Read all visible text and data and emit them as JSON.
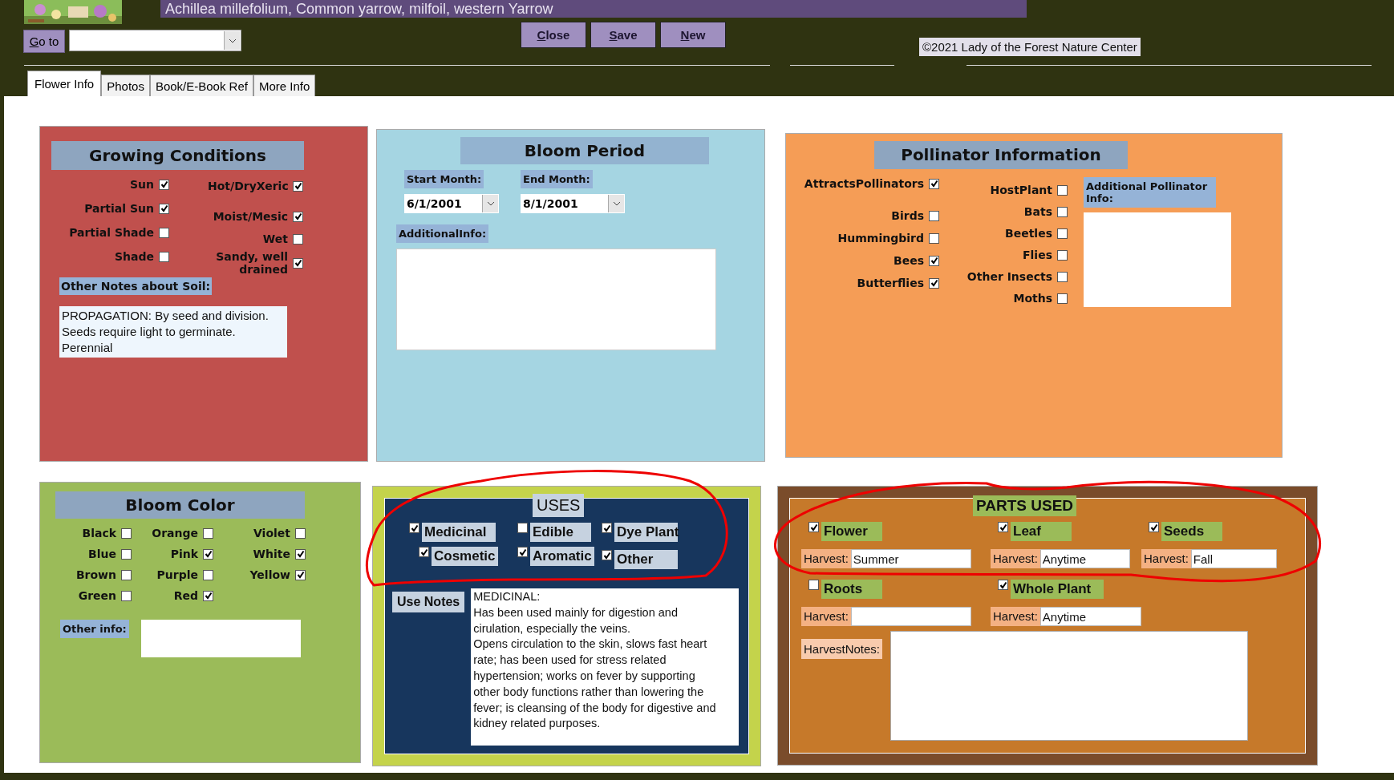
{
  "title": "Achillea millefolium, Common yarrow, milfoil, western Yarrow",
  "goto": {
    "label": "Go to"
  },
  "buttons": [
    "Close",
    "Save",
    "New"
  ],
  "copyright": "©2021 Lady of the Forest Nature Center",
  "tabs": [
    {
      "label": "Flower Info",
      "selected": true
    },
    {
      "label": "Photos",
      "selected": false
    },
    {
      "label": "Book/E-Book Ref",
      "selected": false
    },
    {
      "label": "More Info",
      "selected": false
    }
  ],
  "growing": {
    "title": "Growing Conditions",
    "left": [
      {
        "label": "Sun",
        "checked": true
      },
      {
        "label": "Partial Sun",
        "checked": true
      },
      {
        "label": "Partial Shade",
        "checked": false
      },
      {
        "label": "Shade",
        "checked": false
      }
    ],
    "right": [
      {
        "label": "Hot/DryXeric",
        "checked": true
      },
      {
        "label": "Moist/Mesic",
        "checked": true
      },
      {
        "label": "Wet",
        "checked": false
      },
      {
        "label": "Sandy, well drained",
        "checked": true
      }
    ],
    "notes_label": "Other Notes about Soil:",
    "notes": "PROPAGATION: By seed and division. Seeds require light to germinate. Perennial"
  },
  "bloom_period": {
    "title": "Bloom Period",
    "start": {
      "label": "Start Month:",
      "value": "6/1/2001"
    },
    "end": {
      "label": "End Month:",
      "value": "8/1/2001"
    },
    "info_label": "AdditionalInfo:"
  },
  "pollinators": {
    "title": "Pollinator Information",
    "left": [
      {
        "label": "AttractsPollinators",
        "checked": true
      },
      {
        "label": "Birds",
        "checked": false
      },
      {
        "label": "Hummingbird",
        "checked": false
      },
      {
        "label": "Bees",
        "checked": true
      },
      {
        "label": "Butterflies",
        "checked": true
      }
    ],
    "right": [
      {
        "label": "HostPlant",
        "checked": false
      },
      {
        "label": "Bats",
        "checked": false
      },
      {
        "label": "Beetles",
        "checked": false
      },
      {
        "label": "Flies",
        "checked": false
      },
      {
        "label": "Other Insects",
        "checked": false
      },
      {
        "label": "Moths",
        "checked": false
      }
    ],
    "info_label": "Additional Pollinator Info:"
  },
  "bloom_color": {
    "title": "Bloom Color",
    "colors": [
      {
        "label": "Black",
        "checked": false
      },
      {
        "label": "Orange",
        "checked": false
      },
      {
        "label": "Violet",
        "checked": false
      },
      {
        "label": "Blue",
        "checked": false
      },
      {
        "label": "Pink",
        "checked": true
      },
      {
        "label": "White",
        "checked": true
      },
      {
        "label": "Brown",
        "checked": false
      },
      {
        "label": "Purple",
        "checked": false
      },
      {
        "label": "Yellow",
        "checked": true
      },
      {
        "label": "Green",
        "checked": false
      },
      {
        "label": "Red",
        "checked": true
      }
    ],
    "other_label": "Other info:"
  },
  "uses": {
    "title": "USES",
    "items": [
      {
        "label": "Medicinal",
        "checked": true
      },
      {
        "label": "Edible",
        "checked": false
      },
      {
        "label": "Dye Plant",
        "checked": true
      },
      {
        "label": "Cosmetic",
        "checked": true
      },
      {
        "label": "Aromatic",
        "checked": true
      },
      {
        "label": "Other",
        "checked": true
      }
    ],
    "notes_label": "Use Notes",
    "notes": "MEDICINAL:\nHas been used mainly for digestion and cirulation, especially the veins.\nOpens circulation to the skin, slows fast heart rate; has been used for stress related hypertension; works on fever by supporting other body functions rather than lowering the fever; is cleansing of the body for digestive and kidney related purposes."
  },
  "parts": {
    "title": "PARTS USED",
    "items": [
      {
        "label": "Flower",
        "checked": true,
        "harvest_label": "Harvest:",
        "harvest": "Summer"
      },
      {
        "label": "Leaf",
        "checked": true,
        "harvest_label": "Harvest:",
        "harvest": "Anytime"
      },
      {
        "label": "Seeds",
        "checked": true,
        "harvest_label": "Harvest:",
        "harvest": "Fall"
      },
      {
        "label": "Roots",
        "checked": false,
        "harvest_label": "Harvest:"
      },
      {
        "label": "Whole Plant",
        "checked": true,
        "harvest_label": "Harvest:",
        "harvest": "Anytime"
      }
    ],
    "notes_label": "HarvestNotes:"
  }
}
